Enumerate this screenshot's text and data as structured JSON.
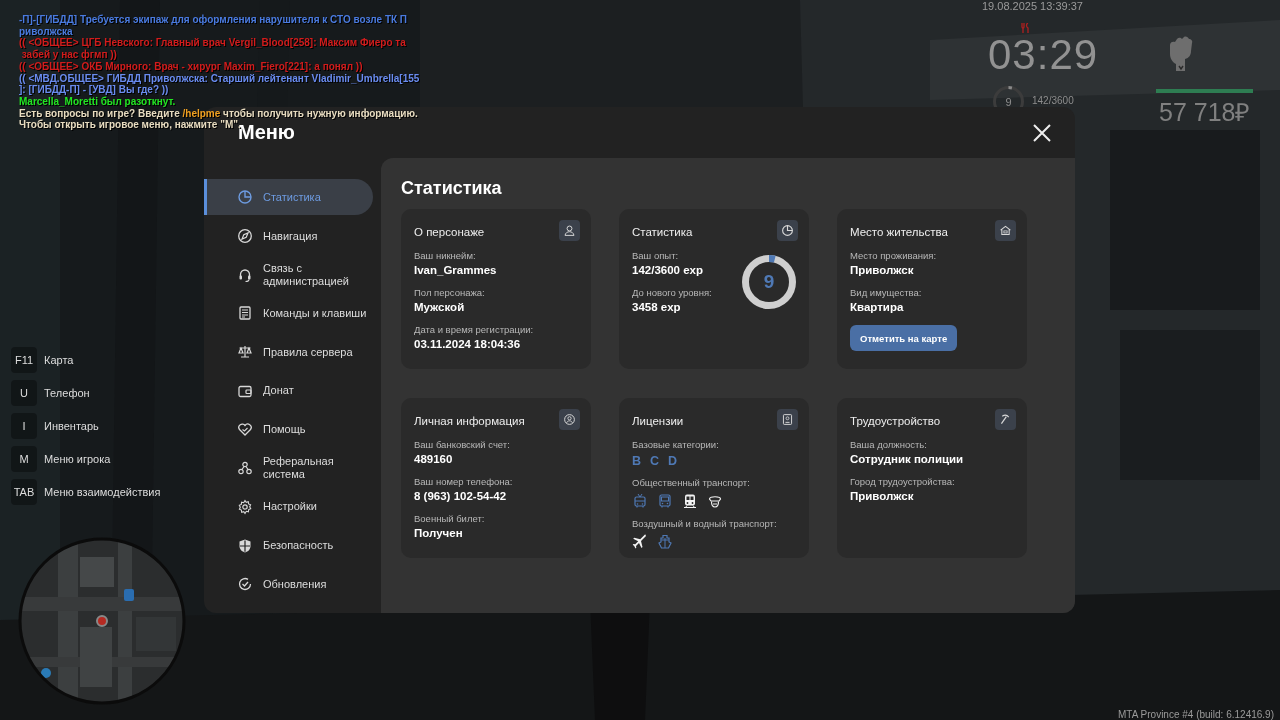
{
  "chat": [
    {
      "segments": [
        {
          "text": "-П]-[ГИБДД] Требуется экипаж для оформления нарушителя к СТО возле ТК П",
          "color": "#4a7be0"
        }
      ]
    },
    {
      "segments": [
        {
          "text": "риволжска",
          "color": "#4a7be0"
        }
      ]
    },
    {
      "segments": [
        {
          "text": "(( <ОБЩЕЕ> ЦГБ Невского: Главный врач Vergil_Blood[258]: Максим Фиеро та",
          "color": "#d21c1c"
        }
      ]
    },
    {
      "segments": [
        {
          "text": " забей у нас фгмп ))",
          "color": "#d21c1c"
        }
      ]
    },
    {
      "segments": [
        {
          "text": "(( <ОБЩЕЕ> ОКБ Мирного: Врач - хирург Maxim_Fiero[221]: а понял ))",
          "color": "#d21c1c"
        }
      ]
    },
    {
      "segments": [
        {
          "text": "(( <МВД.ОБЩЕЕ> ГИБДД Приволжска: Старший лейтенант Vladimir_Umbrella[155",
          "color": "#6a8cf0"
        }
      ]
    },
    {
      "segments": [
        {
          "text": "]: [ГИБДД-П] - [УВД] Вы где? ))",
          "color": "#6a8cf0"
        }
      ]
    },
    {
      "segments": [
        {
          "text": "Marcella_Moretti был разоткнут.",
          "color": "#22e622"
        }
      ]
    },
    {
      "segments": [
        {
          "text": "Есть вопросы по игре? Введите ",
          "color": "#e8dcc0"
        },
        {
          "text": "/helpme",
          "color": "#f0a020"
        },
        {
          "text": " чтобы получить нужную информацию.",
          "color": "#e8dcc0"
        }
      ]
    },
    {
      "segments": [
        {
          "text": "Чтобы открыть игровое меню, нажмите \"M\".",
          "color": "#e8dcc0"
        }
      ]
    }
  ],
  "hud": {
    "datetime": "19.08.2025 13:39:37",
    "clock": "03:29",
    "level": "9",
    "xp": "142/3600",
    "xp_ring": {
      "level": 0.04
    },
    "health": {
      "level": 1
    },
    "money": "57 718₽"
  },
  "key_hints": [
    {
      "key": "F11",
      "label": "Карта"
    },
    {
      "key": "U",
      "label": "Телефон"
    },
    {
      "key": "I",
      "label": "Инвентарь"
    },
    {
      "key": "M",
      "label": "Меню игрока"
    },
    {
      "key": "TAB",
      "label": "Меню взаимодействия"
    }
  ],
  "menu": {
    "title": "Меню",
    "nav": [
      {
        "label": "Статистика",
        "kind": "pie",
        "selected": true
      },
      {
        "label": "Навигация",
        "kind": "compass",
        "selected": false
      },
      {
        "label": "Связь с администрацией",
        "kind": "headset",
        "selected": false
      },
      {
        "label": "Команды и клавиши",
        "kind": "document",
        "selected": false
      },
      {
        "label": "Правила сервера",
        "kind": "scales",
        "selected": false
      },
      {
        "label": "Донат",
        "kind": "wallet",
        "selected": false
      },
      {
        "label": "Помощь",
        "kind": "heart",
        "selected": false
      },
      {
        "label": "Реферальная система",
        "kind": "network",
        "selected": false
      },
      {
        "label": "Настройки",
        "kind": "gear",
        "selected": false
      },
      {
        "label": "Безопасность",
        "kind": "shield",
        "selected": false
      },
      {
        "label": "Обновления",
        "kind": "check",
        "selected": false
      }
    ],
    "content": {
      "title": "Статистика",
      "cards": [
        {
          "title": "О персонаже",
          "kind": "person",
          "fields": [
            {
              "label": "Ваш никнейм:",
              "value": "Ivan_Grammes"
            },
            {
              "label": "Пол персонажа:",
              "value": "Мужской"
            },
            {
              "label": "Дата и время регистрации:",
              "value": "03.11.2024 18:04:36"
            }
          ]
        },
        {
          "title": "Статистика",
          "kind": "pie",
          "fields": [
            {
              "label": "Ваш опыт:",
              "value": "142/3600 exp"
            },
            {
              "label": "До нового уровня:",
              "value": "3458 exp"
            }
          ],
          "ring": {
            "value": "9",
            "level": 0.04
          }
        },
        {
          "title": "Место жительства",
          "kind": "house",
          "fields": [
            {
              "label": "Место проживания:",
              "value": "Приволжск"
            },
            {
              "label": "Вид имущества:",
              "value": "Квартира"
            }
          ],
          "button": "Отметить на карте"
        },
        {
          "title": "Личная информация",
          "kind": "user-circle",
          "fields": [
            {
              "label": "Ваш банковский счет:",
              "value": "489160"
            },
            {
              "label": "Ваш номер телефона:",
              "value": "8 (963) 102-54-42"
            },
            {
              "label": "Военный билет:",
              "value": "Получен"
            }
          ]
        },
        {
          "title": "Лицензии",
          "kind": "id",
          "sections": [
            {
              "label": "Базовые категории:",
              "categories": [
                {
                  "text": "B",
                  "owned": true
                },
                {
                  "text": "C",
                  "owned": true
                },
                {
                  "text": "D",
                  "owned": true
                }
              ]
            },
            {
              "label": "Общественный транспорт:",
              "vehicles": [
                {
                  "kind": "trolleybus",
                  "owned": true
                },
                {
                  "kind": "bus",
                  "owned": true
                },
                {
                  "kind": "train",
                  "owned": false
                },
                {
                  "kind": "cap",
                  "owned": false
                }
              ]
            },
            {
              "label": "Воздушный и водный транспорт:",
              "vehicles": [
                {
                  "kind": "plane",
                  "owned": false
                },
                {
                  "kind": "ship",
                  "owned": true
                }
              ]
            }
          ]
        },
        {
          "title": "Трудоустройство",
          "kind": "pickaxe",
          "fields": [
            {
              "label": "Ваша должность:",
              "value": "Сотрудник полиции"
            },
            {
              "label": "Город трудоустройства:",
              "value": "Приволжск"
            }
          ]
        }
      ]
    }
  },
  "footer": "MTA Province #4 (build: 6.12416.9)"
}
